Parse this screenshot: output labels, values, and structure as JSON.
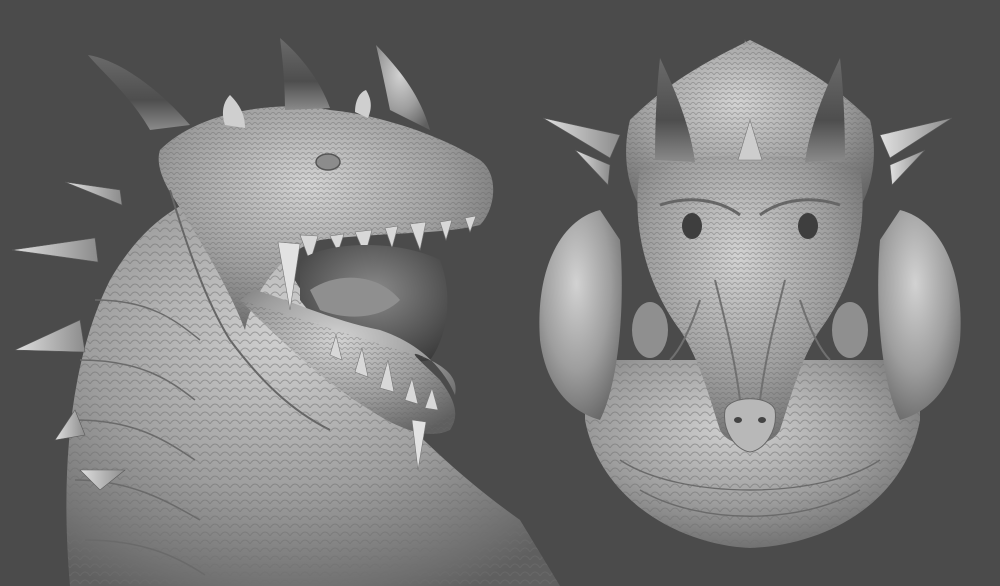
{
  "scene": {
    "background_color": "#4b4b4b",
    "material_color": "#a3a3a3",
    "views": [
      {
        "name": "side-three-quarter-view",
        "subject": "dragon-head-sculpt"
      },
      {
        "name": "front-view",
        "subject": "dragon-head-sculpt"
      }
    ]
  }
}
